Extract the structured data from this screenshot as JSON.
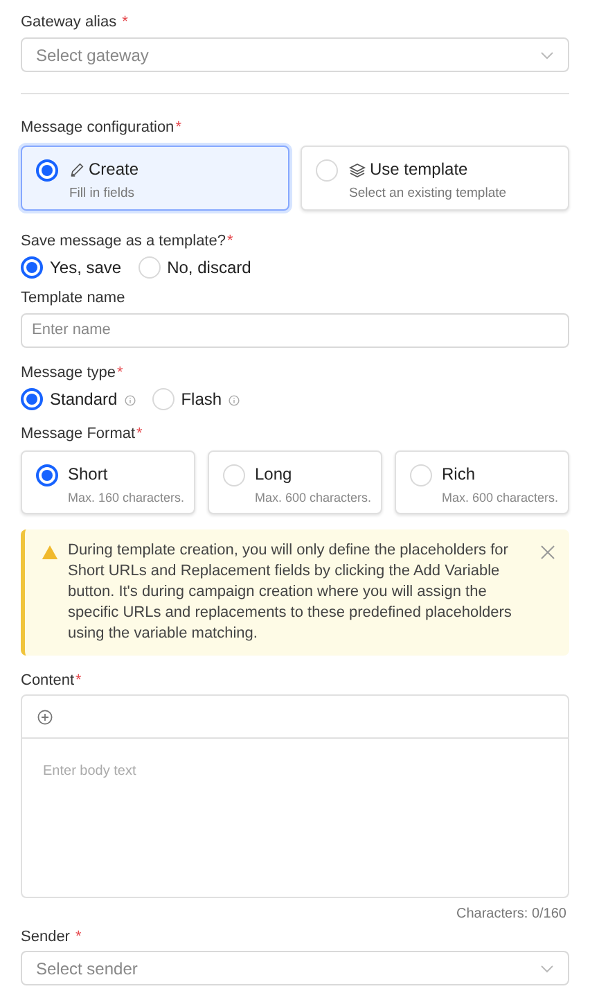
{
  "gateway": {
    "label": "Gateway alias",
    "required_mark": "*",
    "placeholder": "Select gateway"
  },
  "message_configuration": {
    "label": "Message configuration",
    "required_mark": "*",
    "options": [
      {
        "kind": "create",
        "title": "Create",
        "description": "Fill in fields",
        "selected": true
      },
      {
        "kind": "template",
        "title": "Use template",
        "description": "Select an existing template",
        "selected": false
      }
    ]
  },
  "save_template": {
    "label": "Save message as a template?",
    "required_mark": "*",
    "options": [
      {
        "label": "Yes, save",
        "selected": true
      },
      {
        "label": "No, discard",
        "selected": false
      }
    ]
  },
  "template_name": {
    "label": "Template name",
    "placeholder": "Enter name"
  },
  "message_type": {
    "label": "Message type",
    "required_mark": "*",
    "options": [
      {
        "label": "Standard",
        "selected": true
      },
      {
        "label": "Flash",
        "selected": false
      }
    ]
  },
  "message_format": {
    "label": "Message Format",
    "required_mark": "*",
    "options": [
      {
        "title": "Short",
        "description": "Max. 160 characters.",
        "selected": true
      },
      {
        "title": "Long",
        "description": "Max. 600 characters.",
        "selected": false
      },
      {
        "title": "Rich",
        "description": "Max. 600 characters.",
        "selected": false
      }
    ]
  },
  "alert": {
    "text": "During template creation, you will only define the placeholders for Short URLs and Replacement fields by clicking the Add Variable button. It's during campaign creation where you will assign the specific URLs and replacements to these predefined placeholders using the variable matching."
  },
  "content": {
    "label": "Content",
    "required_mark": "*",
    "placeholder": "Enter body text",
    "counter": "Characters: 0/160"
  },
  "sender": {
    "label": "Sender",
    "required_mark": "*",
    "placeholder": "Select sender"
  }
}
